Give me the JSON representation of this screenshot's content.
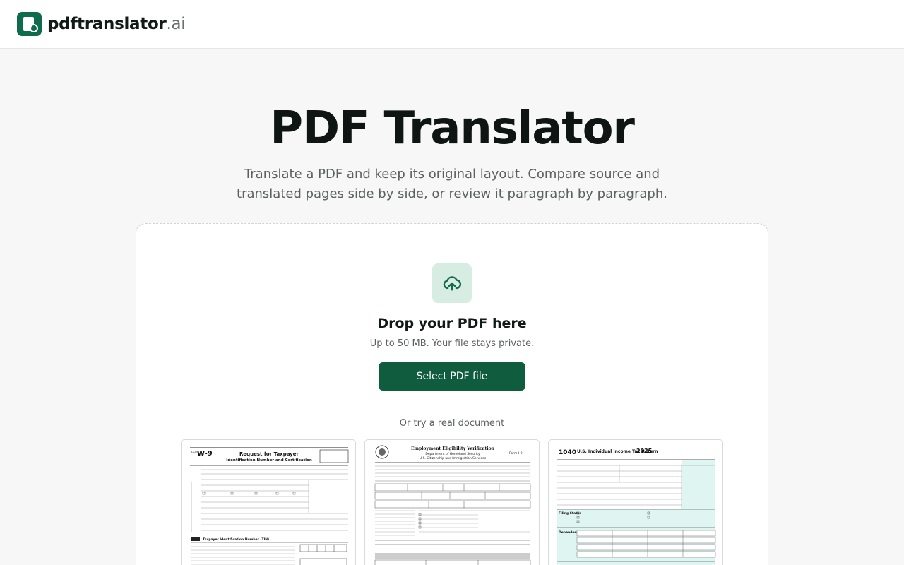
{
  "header": {
    "logo_name": "pdftranslator",
    "logo_tld": ".ai"
  },
  "hero": {
    "title": "PDF Translator",
    "subtitle": "Translate a PDF and keep its original layout. Compare source and translated pages side by side, or review it paragraph by paragraph."
  },
  "upload": {
    "icon": "cloud-upload-icon",
    "title": "Drop your PDF here",
    "note": "Up to 50 MB. Your file stays private.",
    "button_label": "Select PDF file",
    "try_label": "Or try a real document"
  },
  "samples": [
    {
      "id": "w9",
      "form_code": "W-9",
      "title": "Request for Taxpayer",
      "title2": "Identification Number and Certification",
      "section": "Taxpayer Identification Number (TIN)"
    },
    {
      "id": "i9",
      "title": "Employment Eligibility Verification",
      "agency": "Department of Homeland Security",
      "agency2": "U.S. Citizenship and Immigration Services",
      "form_code": "Form I-9"
    },
    {
      "id": "f1040",
      "form_code": "1040",
      "title": "U.S. Individual Income Tax Return",
      "year": "2025",
      "filing_label": "Filing Status",
      "dependents_label": "Dependents"
    }
  ],
  "colors": {
    "accent": "#0f5c3f",
    "accent_light": "#d7ece2",
    "form_1040_tint": "#dff5f2"
  }
}
